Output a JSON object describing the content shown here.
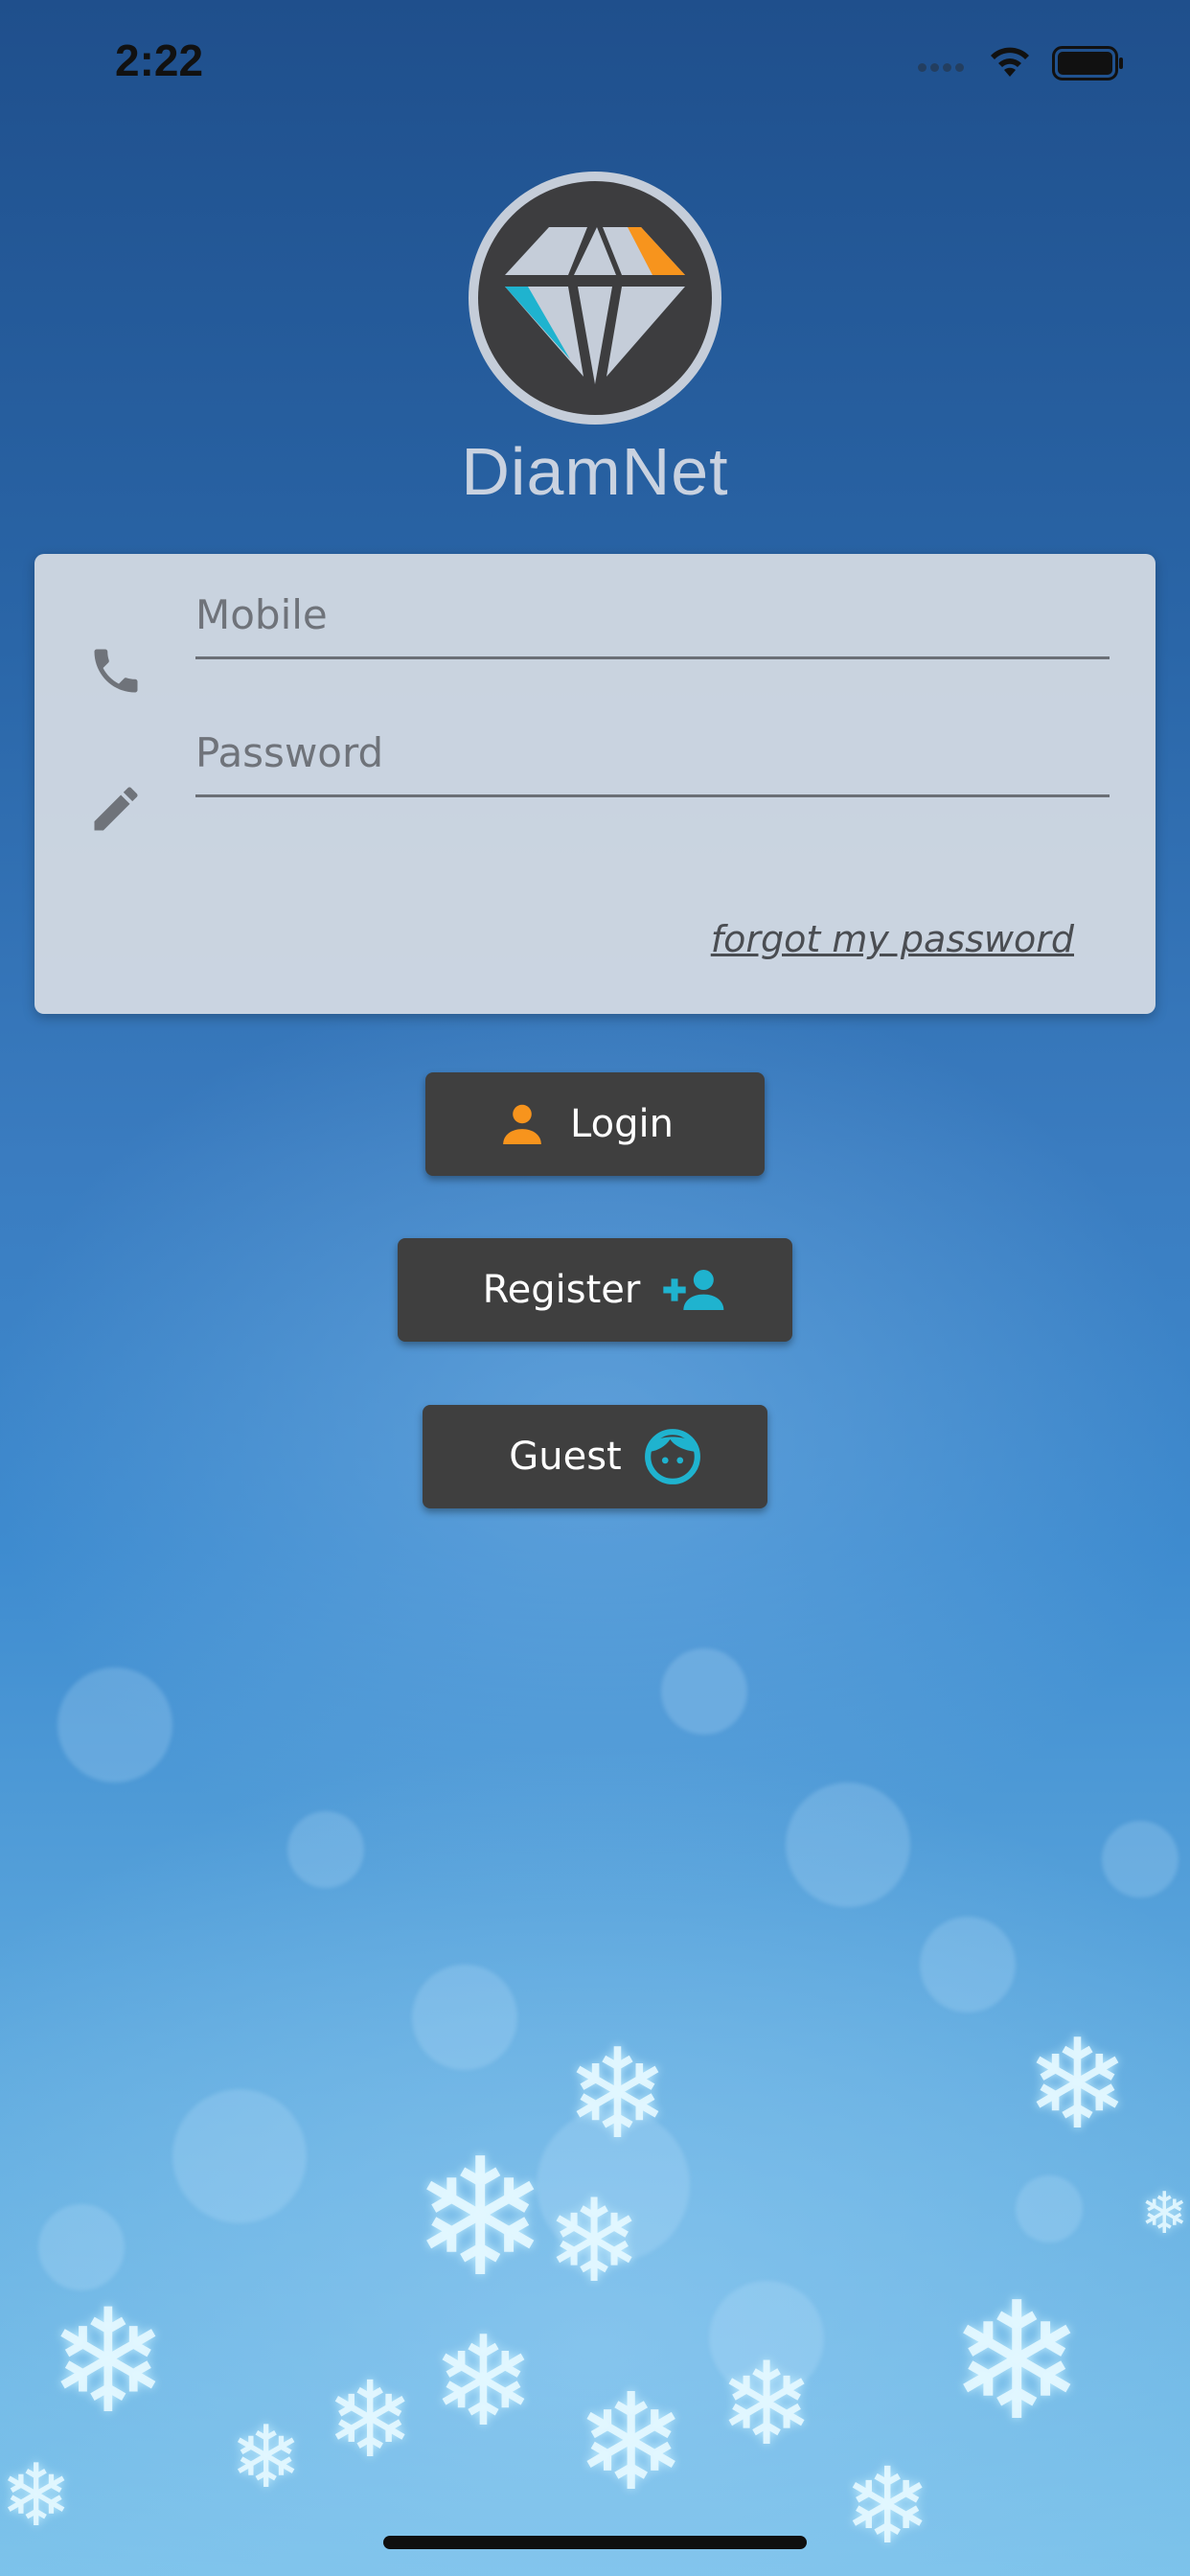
{
  "status_bar": {
    "time": "2:22",
    "icons": [
      "cellular-dots-icon",
      "wifi-icon",
      "battery-icon"
    ]
  },
  "brand": {
    "app_name": "DiamNet",
    "logo_icon": "diamond-logo-icon",
    "colors": {
      "logo_ring": "#3d3d3f",
      "logo_accent_orange": "#f7941d",
      "logo_accent_cyan": "#1fb3cf",
      "logo_facets": "#c5cdd9"
    }
  },
  "login_form": {
    "mobile_placeholder": "Mobile",
    "mobile_value": "",
    "mobile_icon": "phone-icon",
    "password_placeholder": "Password",
    "password_value": "",
    "password_icon": "pencil-icon",
    "forgot_password_label": "forgot my password"
  },
  "actions": {
    "login_label": "Login",
    "login_icon": "person-icon",
    "register_label": "Register",
    "register_icon": "add-person-icon",
    "guest_label": "Guest",
    "guest_icon": "face-icon",
    "colors": {
      "button_bg": "#3f3f3f",
      "login_icon": "#f7941d",
      "register_icon": "#1fb3cf",
      "guest_icon": "#1fb3cf"
    }
  },
  "background": {
    "theme": "blue bokeh with snowflakes"
  }
}
